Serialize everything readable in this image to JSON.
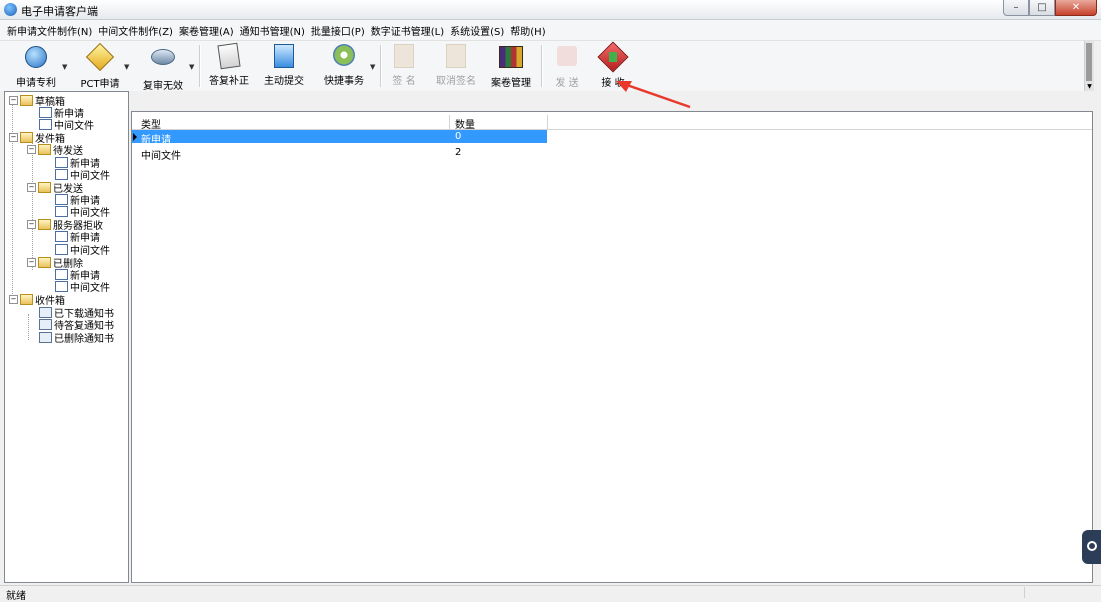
{
  "window": {
    "title": "电子申请客户端"
  },
  "menu": [
    "新申请文件制作(N)",
    "中间文件制作(Z)",
    "案卷管理(A)",
    "通知书管理(N)",
    "批量接口(P)",
    "数字证书管理(L)",
    "系统设置(S)",
    "帮助(H)"
  ],
  "toolbar": {
    "apply_patent": "申请专利",
    "pct_apply": "PCT申请",
    "review_invalid": "复审无效",
    "reply_correct": "答复补正",
    "active_submit": "主动提交",
    "quick_tasks": "快捷事务",
    "sign": "签 名",
    "cancel_sign": "取消签名",
    "case_manage": "案卷管理",
    "send": "发 送",
    "receive": "接 收"
  },
  "tree": {
    "drafts": "草稿箱",
    "drafts_new": "新申请",
    "drafts_mid": "中间文件",
    "outbox": "发件箱",
    "pending": "待发送",
    "pending_new": "新申请",
    "pending_mid": "中间文件",
    "sent": "已发送",
    "sent_new": "新申请",
    "sent_mid": "中间文件",
    "rejected": "服务器拒收",
    "rejected_new": "新申请",
    "rejected_mid": "中间文件",
    "deleted": "已删除",
    "deleted_new": "新申请",
    "deleted_mid": "中间文件",
    "inbox": "收件箱",
    "downloaded": "已下载通知书",
    "to_reply": "待答复通知书",
    "deleted_notices": "已删除通知书"
  },
  "grid": {
    "col_type": "类型",
    "col_count": "数量",
    "rows": [
      {
        "type": "新申请",
        "count": "0"
      },
      {
        "type": "中间文件",
        "count": "2"
      }
    ]
  },
  "status": {
    "text": "就绪"
  },
  "colors": {
    "selection": "#3399ff",
    "annotation_arrow": "#e8392c"
  }
}
